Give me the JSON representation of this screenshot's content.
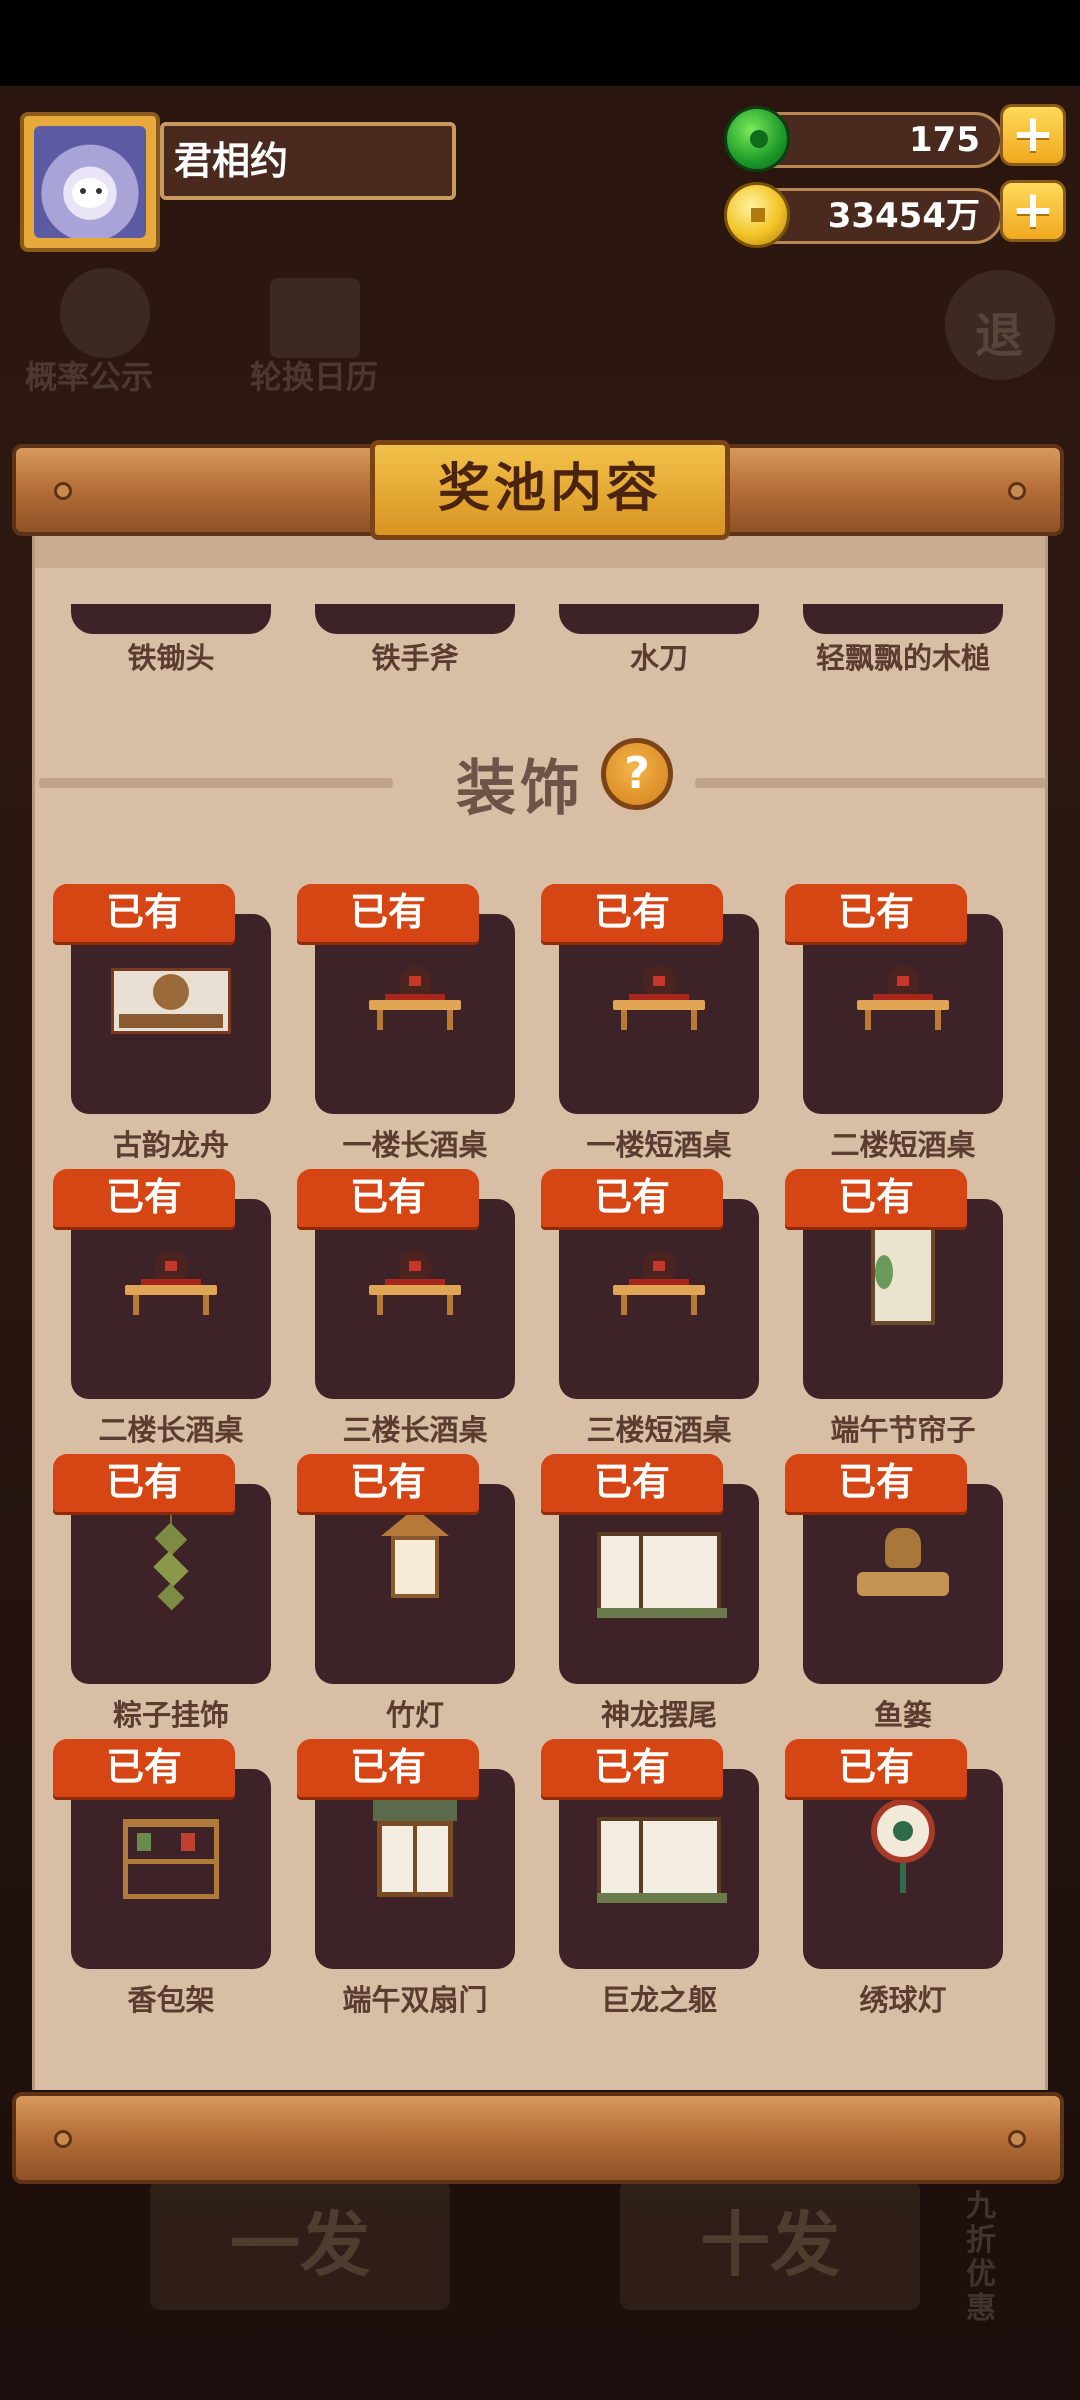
{
  "player": {
    "name": "君相约"
  },
  "currency": {
    "jade": {
      "icon": "jade-icon",
      "value": "175"
    },
    "coins": {
      "icon": "coin-icon",
      "value": "33454万"
    },
    "plus": "+"
  },
  "background_ui": {
    "probability": "概率公示",
    "calendar": "轮换日历",
    "exit": "退",
    "draw_one": "一发",
    "draw_ten": "十发",
    "discount": "九折优惠"
  },
  "dialog": {
    "title": "奖池内容",
    "previous_row": [
      "铁锄头",
      "铁手斧",
      "水刀",
      "轻飘飘的木槌"
    ],
    "section_title": "装饰",
    "help": "?",
    "owned_tag": "已有",
    "items": [
      {
        "name": "古韵龙舟",
        "icon": "dragon-boat-drum-icon"
      },
      {
        "name": "一楼长酒桌",
        "icon": "wine-table-icon"
      },
      {
        "name": "一楼短酒桌",
        "icon": "wine-table-icon"
      },
      {
        "name": "二楼短酒桌",
        "icon": "wine-table-icon"
      },
      {
        "name": "二楼长酒桌",
        "icon": "wine-table-icon"
      },
      {
        "name": "三楼长酒桌",
        "icon": "wine-table-icon"
      },
      {
        "name": "三楼短酒桌",
        "icon": "wine-table-icon"
      },
      {
        "name": "端午节帘子",
        "icon": "curtain-icon"
      },
      {
        "name": "粽子挂饰",
        "icon": "zongzi-ornament-icon"
      },
      {
        "name": "竹灯",
        "icon": "bamboo-lamp-icon"
      },
      {
        "name": "神龙摆尾",
        "icon": "dragon-window-icon"
      },
      {
        "name": "鱼篓",
        "icon": "fish-basket-icon"
      },
      {
        "name": "香包架",
        "icon": "sachet-rack-icon"
      },
      {
        "name": "端午双扇门",
        "icon": "double-door-icon"
      },
      {
        "name": "巨龙之躯",
        "icon": "dragon-body-window-icon"
      },
      {
        "name": "绣球灯",
        "icon": "embroidered-ball-lamp-icon"
      }
    ]
  },
  "colors": {
    "owned_tag": "#d64514",
    "card": "#3d2227",
    "panel": "#d8bea4",
    "title_plaque": "#e8ac35"
  }
}
